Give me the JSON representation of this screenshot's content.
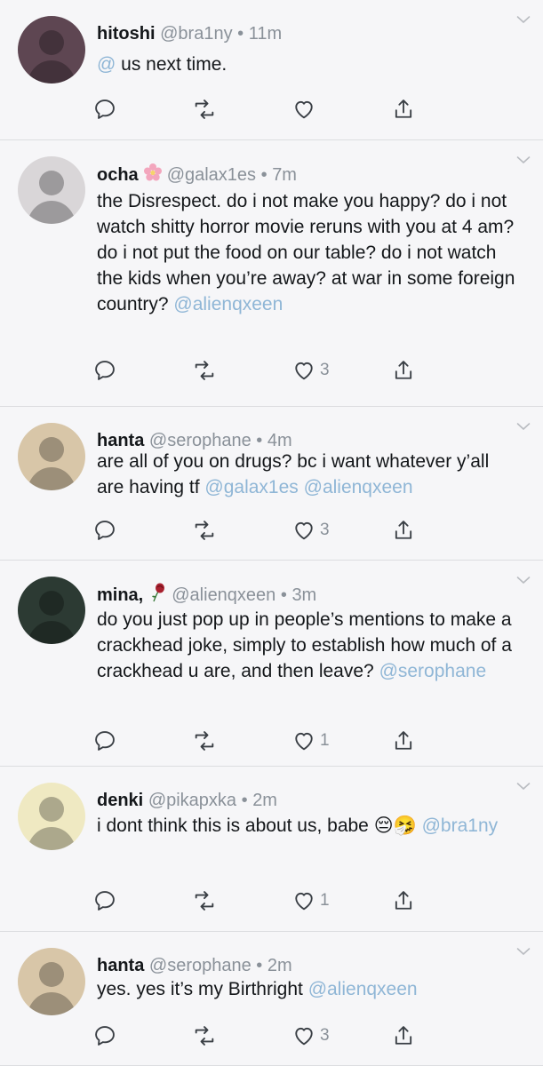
{
  "tweets": [
    {
      "name": "hitoshi",
      "emoji": "",
      "handle": "@bra1ny",
      "time": "11m",
      "text": [
        {
          "t": "@",
          "m": true
        },
        {
          "t": " us next time.",
          "m": false
        }
      ],
      "likes": "",
      "avatar_bg": "#5e4652"
    },
    {
      "name": "ocha",
      "emoji": "flower",
      "handle": "@galax1es",
      "time": "7m",
      "text": [
        {
          "t": "the Disrespect. do i not make you happy? do i not watch shitty horror movie reruns with you at 4 am? do i not put the food on our table? do i not watch the kids when you’re away? at war in some foreign country? ",
          "m": false
        },
        {
          "t": "@alienqxeen",
          "m": true
        }
      ],
      "likes": "3",
      "avatar_bg": "#d9d6d8"
    },
    {
      "name": "hanta",
      "emoji": "",
      "handle": "@serophane",
      "time": "4m",
      "text": [
        {
          "t": "are all of you on drugs? bc i want whatever y’all are having tf ",
          "m": false
        },
        {
          "t": "@galax1es @alienqxeen",
          "m": true
        }
      ],
      "likes": "3",
      "avatar_bg": "#d8c6a8"
    },
    {
      "name": "mina,",
      "emoji": "rose",
      "handle": "@alienqxeen",
      "time": "3m",
      "text": [
        {
          "t": "do you just pop up in people’s mentions to make a crackhead joke, simply to establish how much of a crackhead u are, and then leave? ",
          "m": false
        },
        {
          "t": "@serophane",
          "m": true
        }
      ],
      "likes": "1",
      "avatar_bg": "#2c3a33"
    },
    {
      "name": "denki",
      "emoji": "",
      "handle": "@pikapxka",
      "time": "2m",
      "text": [
        {
          "t": "i dont think this is about us, babe ",
          "m": false
        },
        {
          "t": "😔🤧",
          "m": false,
          "e": true
        },
        {
          "t": " ",
          "m": false
        },
        {
          "t": "@bra1ny",
          "m": true
        }
      ],
      "likes": "1",
      "avatar_bg": "#efe9c2"
    },
    {
      "name": "hanta",
      "emoji": "",
      "handle": "@serophane",
      "time": "2m",
      "text": [
        {
          "t": "yes. yes it’s my Birthright ",
          "m": false
        },
        {
          "t": "@alienqxeen",
          "m": true
        }
      ],
      "likes": "3",
      "avatar_bg": "#d8c6a8"
    }
  ],
  "colors": {
    "mention": "#8fb6d6",
    "muted": "#8a9199",
    "icon": "#3a3f45",
    "divider": "#dcdde0"
  }
}
